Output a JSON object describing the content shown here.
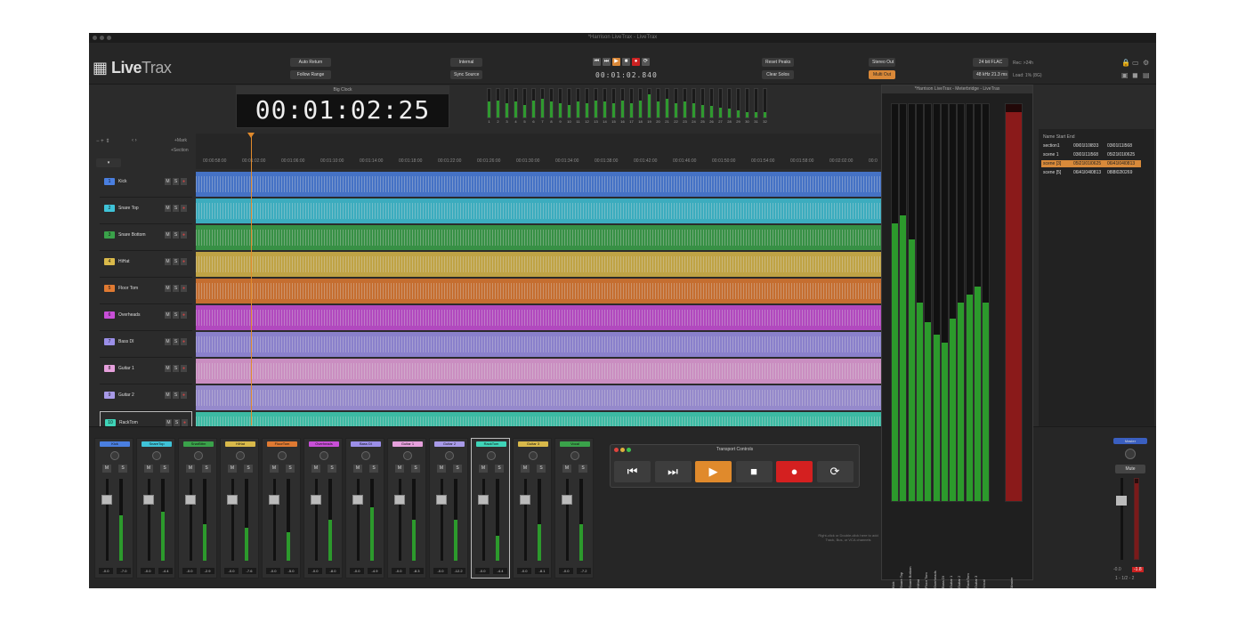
{
  "window_title": "*Harrison LiveTrax - LiveTrax",
  "logo": {
    "a": "Live",
    "b": "Trax"
  },
  "header": {
    "auto_return": "Auto Return",
    "follow_range": "Follow Range",
    "internal": "Internal",
    "sync_source": "Sync Source",
    "time": "00:01:02.840",
    "reset_peaks": "Reset Peaks",
    "clear_solos": "Clear Solos",
    "stereo_out": "Stereo Out",
    "multi_out": "Multi Out",
    "format": "24 bit FLAC",
    "rec": "Rec: >24h",
    "rate": "48 kHz 21.3 ms",
    "load": "Load:  1% (8G)"
  },
  "big_clock": {
    "title": "Big Clock",
    "time": "00:01:02:25"
  },
  "input_meters": {
    "labels": [
      "1",
      "2",
      "3",
      "4",
      "5",
      "6",
      "7",
      "8",
      "9",
      "10",
      "11",
      "12",
      "13",
      "14",
      "15",
      "16",
      "17",
      "18",
      "19",
      "20",
      "21",
      "22",
      "23",
      "24",
      "25",
      "26",
      "27",
      "28",
      "29",
      "30",
      "31",
      "32"
    ],
    "levels": [
      0.55,
      0.6,
      0.5,
      0.55,
      0.45,
      0.6,
      0.65,
      0.55,
      0.5,
      0.45,
      0.55,
      0.5,
      0.6,
      0.55,
      0.5,
      0.6,
      0.5,
      0.6,
      0.8,
      0.55,
      0.65,
      0.5,
      0.55,
      0.5,
      0.45,
      0.4,
      0.35,
      0.3,
      0.25,
      0.2,
      0.2,
      0.2
    ]
  },
  "ruler": {
    "mark": "+Mark",
    "section": "+Section",
    "ticks": [
      "00:00:58:00",
      "00:01:02:00",
      "00:01:06:00",
      "00:01:10:00",
      "00:01:14:00",
      "00:01:18:00",
      "00:01:22:00",
      "00:01:26:00",
      "00:01:30:00",
      "00:01:34:00",
      "00:01:38:00",
      "00:01:42:00",
      "00:01:46:00",
      "00:01:50:00",
      "00:01:54:00",
      "00:01:58:00",
      "00:02:02:00",
      "00:0"
    ]
  },
  "tracks": [
    {
      "num": "1",
      "name": "Kick",
      "color": "#4a7fe0"
    },
    {
      "num": "2",
      "name": "Snare Top",
      "color": "#3fc3d8"
    },
    {
      "num": "3",
      "name": "Snare Bottom",
      "color": "#3aa24a"
    },
    {
      "num": "4",
      "name": "HiHat",
      "color": "#d9b94a"
    },
    {
      "num": "5",
      "name": "Floor Tom",
      "color": "#e07a32"
    },
    {
      "num": "6",
      "name": "Overheads",
      "color": "#c94fd8"
    },
    {
      "num": "7",
      "name": "Bass DI",
      "color": "#9b8fe8"
    },
    {
      "num": "8",
      "name": "Guitar 1",
      "color": "#e6a0dc"
    },
    {
      "num": "9",
      "name": "Guitar 2",
      "color": "#a89ae8"
    },
    {
      "num": "10",
      "name": "RackTom",
      "color": "#3fd4b8"
    }
  ],
  "track_buttons": {
    "m": "M",
    "s": "S"
  },
  "meterbridge": {
    "title": "*Harrison LiveTrax - Meterbridge - LiveTrax",
    "labels": [
      "Kick",
      "Snare Top",
      "Snare Bottom",
      "HiHat",
      "Floor Tom",
      "Overheads",
      "Bass DI",
      "Guitar 1",
      "Guitar 2",
      "RackTom",
      "Guitar 3",
      "Vocal"
    ],
    "levels": [
      0.7,
      0.72,
      0.66,
      0.5,
      0.45,
      0.42,
      0.4,
      0.46,
      0.5,
      0.52,
      0.54,
      0.5
    ],
    "master": "Master"
  },
  "markers": {
    "header": "Name  Start  End",
    "rows": [
      {
        "name": "section1",
        "start": "00l01l10l833",
        "end": "03l01l11l568",
        "sel": false
      },
      {
        "name": "scene 1",
        "start": "03l01l11l568",
        "end": "05l21l01l0625",
        "sel": false
      },
      {
        "name": "scene [3]",
        "start": "05l21l01l0625",
        "end": "06l41l04l0813",
        "sel": true
      },
      {
        "name": "scene [5]",
        "start": "06l41l04l0813",
        "end": "08l8l02l0269",
        "sel": false
      }
    ]
  },
  "mixer": {
    "strips": [
      {
        "name": "Kick",
        "color": "#4a7fe0",
        "val": "-0.0",
        "peak": "-7.0",
        "level": 0.55
      },
      {
        "name": "SnareTop",
        "color": "#3fc3d8",
        "val": "-0.0",
        "peak": "-4.4",
        "level": 0.6
      },
      {
        "name": "SnarBttm",
        "color": "#3aa24a",
        "val": "-0.0",
        "peak": "-2.9",
        "level": 0.45
      },
      {
        "name": "HiHat",
        "color": "#d9b94a",
        "val": "-0.0",
        "peak": "-7.6",
        "level": 0.4
      },
      {
        "name": "FloorTom",
        "color": "#e07a32",
        "val": "-0.0",
        "peak": "-5.0",
        "level": 0.35
      },
      {
        "name": "Overheads",
        "color": "#c94fd8",
        "val": "-0.0",
        "peak": "-8.0",
        "level": 0.5
      },
      {
        "name": "Bass DI",
        "color": "#9b8fe8",
        "val": "-0.0",
        "peak": "-4.9",
        "level": 0.65
      },
      {
        "name": "Guitar 1",
        "color": "#e6a0dc",
        "val": "-0.0",
        "peak": "-8.3",
        "level": 0.5
      },
      {
        "name": "Guitar 2",
        "color": "#a89ae8",
        "val": "-0.0",
        "peak": "-12.2",
        "level": 0.5
      },
      {
        "name": "RackTom",
        "color": "#3fd4b8",
        "val": "-0.0",
        "peak": "-4.4",
        "level": 0.3,
        "sel": true
      },
      {
        "name": "Guitar 3",
        "color": "#d9b94a",
        "val": "-0.0",
        "peak": "-8.1",
        "level": 0.45
      },
      {
        "name": "Vocal",
        "color": "#3aa24a",
        "val": "-0.0",
        "peak": "-7.2",
        "level": 0.45
      }
    ],
    "mute": "M",
    "solo": "S",
    "master": {
      "name": "Master",
      "mute": "Mute",
      "val": "-0.0",
      "peak": "-1.8",
      "meter": "1 - 1/2 - 2"
    }
  },
  "transport": {
    "title": "Transport Controls",
    "buttons": [
      {
        "name": "rewind-to-start",
        "glyph": "⏮"
      },
      {
        "name": "forward-to-end",
        "glyph": "⏭"
      },
      {
        "name": "play",
        "glyph": "▶"
      },
      {
        "name": "stop",
        "glyph": "■"
      },
      {
        "name": "record",
        "glyph": "●"
      },
      {
        "name": "loop",
        "glyph": "⟳"
      }
    ]
  },
  "hint": "Right-click or Double-click here to add Track, Bus, or VCA channels"
}
